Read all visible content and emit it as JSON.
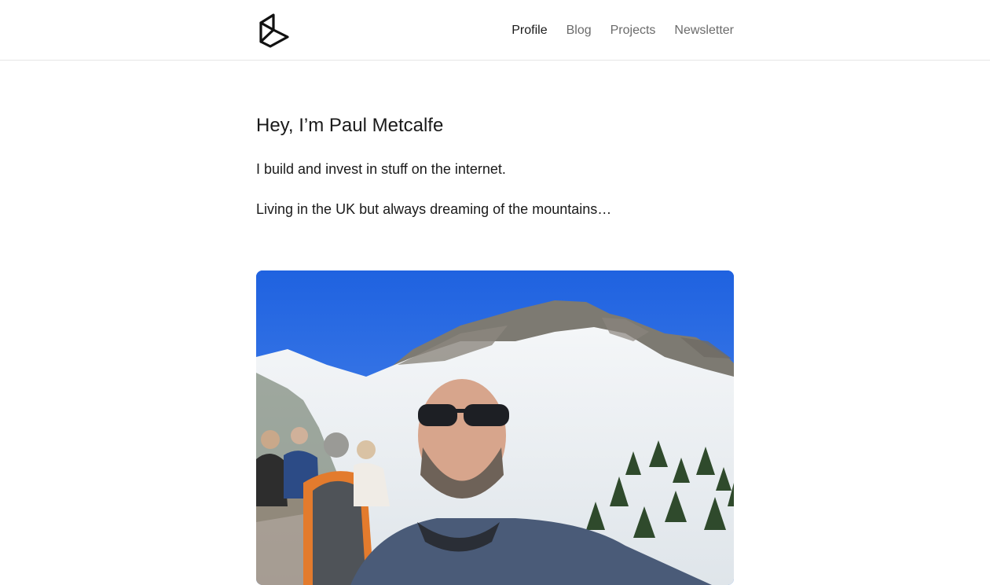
{
  "header": {
    "nav": [
      {
        "label": "Profile",
        "active": true
      },
      {
        "label": "Blog",
        "active": false
      },
      {
        "label": "Projects",
        "active": false
      },
      {
        "label": "Newsletter",
        "active": false
      }
    ]
  },
  "main": {
    "heading": "Hey, I’m Paul Metcalfe",
    "paragraphs": [
      "I build and invest in stuff on the internet.",
      "Living in the UK but always dreaming of the mountains…"
    ]
  },
  "colors": {
    "text": "#1a1a1a",
    "nav_inactive": "#6b6b6b",
    "sky": "#2f6ee6"
  }
}
